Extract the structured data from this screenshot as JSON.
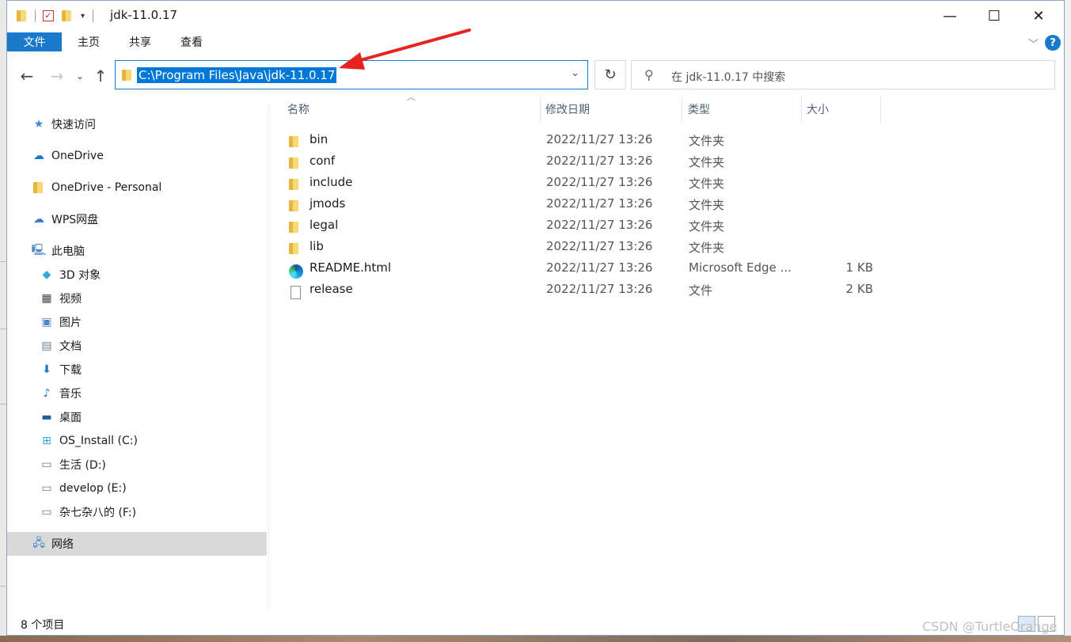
{
  "window": {
    "title": "jdk-11.0.17",
    "controls": {
      "minimize": "—",
      "maximize": "☐",
      "close": "✕"
    }
  },
  "ribbon": {
    "tabs": [
      "文件",
      "主页",
      "共享",
      "查看"
    ],
    "help": "?"
  },
  "address": {
    "path": "C:\\Program Files\\Java\\jdk-11.0.17"
  },
  "search": {
    "placeholder": "在 jdk-11.0.17 中搜索"
  },
  "nav": {
    "items": [
      {
        "label": "快速访问",
        "icon": "star-icon"
      },
      {
        "label": "OneDrive",
        "icon": "cloud-icon"
      },
      {
        "label": "OneDrive - Personal",
        "icon": "folder-icon"
      },
      {
        "label": "WPS网盘",
        "icon": "cloud-icon"
      },
      {
        "label": "此电脑",
        "icon": "computer-icon"
      },
      {
        "label": "3D 对象",
        "icon": "cube-icon"
      },
      {
        "label": "视频",
        "icon": "film-icon"
      },
      {
        "label": "图片",
        "icon": "picture-icon"
      },
      {
        "label": "文档",
        "icon": "document-icon"
      },
      {
        "label": "下载",
        "icon": "download-icon"
      },
      {
        "label": "音乐",
        "icon": "music-icon"
      },
      {
        "label": "桌面",
        "icon": "desktop-icon"
      },
      {
        "label": "OS_Install (C:)",
        "icon": "drive-icon"
      },
      {
        "label": "生活 (D:)",
        "icon": "drive-icon"
      },
      {
        "label": "develop (E:)",
        "icon": "drive-icon"
      },
      {
        "label": "杂七杂八的 (F:)",
        "icon": "drive-icon"
      },
      {
        "label": "网络",
        "icon": "network-icon"
      }
    ],
    "selected": "OS_Install (C:)"
  },
  "columns": [
    "名称",
    "修改日期",
    "类型",
    "大小"
  ],
  "files": [
    {
      "name": "bin",
      "date": "2022/11/27 13:26",
      "type": "文件夹",
      "size": "",
      "icon": "folder-icon"
    },
    {
      "name": "conf",
      "date": "2022/11/27 13:26",
      "type": "文件夹",
      "size": "",
      "icon": "folder-icon"
    },
    {
      "name": "include",
      "date": "2022/11/27 13:26",
      "type": "文件夹",
      "size": "",
      "icon": "folder-icon"
    },
    {
      "name": "jmods",
      "date": "2022/11/27 13:26",
      "type": "文件夹",
      "size": "",
      "icon": "folder-icon"
    },
    {
      "name": "legal",
      "date": "2022/11/27 13:26",
      "type": "文件夹",
      "size": "",
      "icon": "folder-icon"
    },
    {
      "name": "lib",
      "date": "2022/11/27 13:26",
      "type": "文件夹",
      "size": "",
      "icon": "folder-icon"
    },
    {
      "name": "README.html",
      "date": "2022/11/27 13:26",
      "type": "Microsoft Edge ...",
      "size": "1 KB",
      "icon": "edge-icon"
    },
    {
      "name": "release",
      "date": "2022/11/27 13:26",
      "type": "文件",
      "size": "2 KB",
      "icon": "file-icon"
    }
  ],
  "status": {
    "count": "8 个项目"
  },
  "watermark": "CSDN @TurtleOrange",
  "colors": {
    "accent": "#1979ca",
    "selection": "#0078d7",
    "annotation_arrow": "#e8231f"
  }
}
